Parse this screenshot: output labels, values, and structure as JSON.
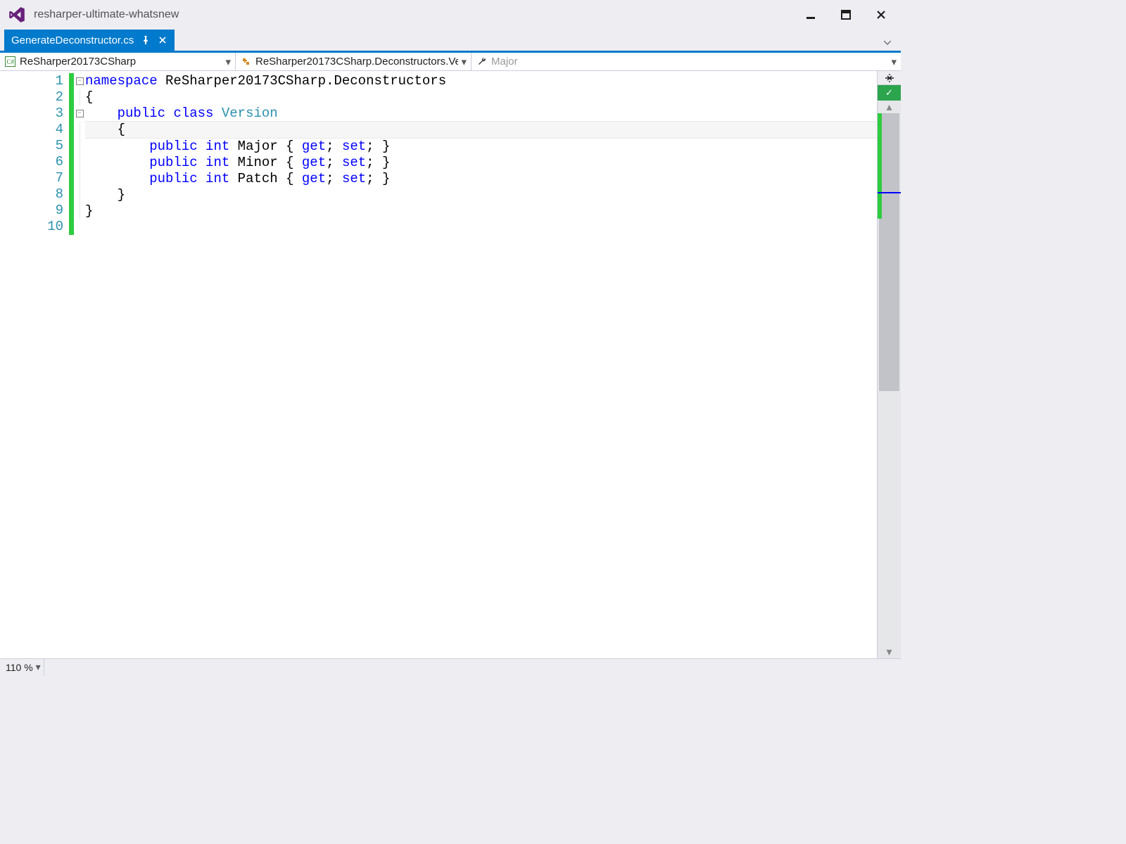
{
  "titlebar": {
    "title": "resharper-ultimate-whatsnew"
  },
  "tab": {
    "filename": "GenerateDeconstructor.cs"
  },
  "navbar": {
    "project": "ReSharper20173CSharp",
    "class": "ReSharper20173CSharp.Deconstructors.Ve",
    "member": "Major"
  },
  "code": {
    "line_count": 10,
    "lines": [
      {
        "n": 1,
        "full": "namespace ReSharper20173CSharp.Deconstructors"
      },
      {
        "n": 2,
        "full": "{"
      },
      {
        "n": 3,
        "full": "    public class Version"
      },
      {
        "n": 4,
        "full": "    {"
      },
      {
        "n": 5,
        "full": "        public int Major { get; set; }"
      },
      {
        "n": 6,
        "full": "        public int Minor { get; set; }"
      },
      {
        "n": 7,
        "full": "        public int Patch { get; set; }"
      },
      {
        "n": 8,
        "full": "    }"
      },
      {
        "n": 9,
        "full": "}"
      },
      {
        "n": 10,
        "full": ""
      }
    ],
    "tokens": {
      "namespace_kw": "namespace",
      "namespace_name": "ReSharper20173CSharp.Deconstructors",
      "public_kw": "public",
      "class_kw": "class",
      "class_name": "Version",
      "int_kw": "int",
      "prop_major": "Major",
      "prop_minor": "Minor",
      "prop_patch": "Patch",
      "get_kw": "get",
      "set_kw": "set",
      "brace_open": "{",
      "brace_close": "}",
      "semi": ";"
    },
    "current_line": 4
  },
  "status": {
    "zoom": "110 %"
  }
}
